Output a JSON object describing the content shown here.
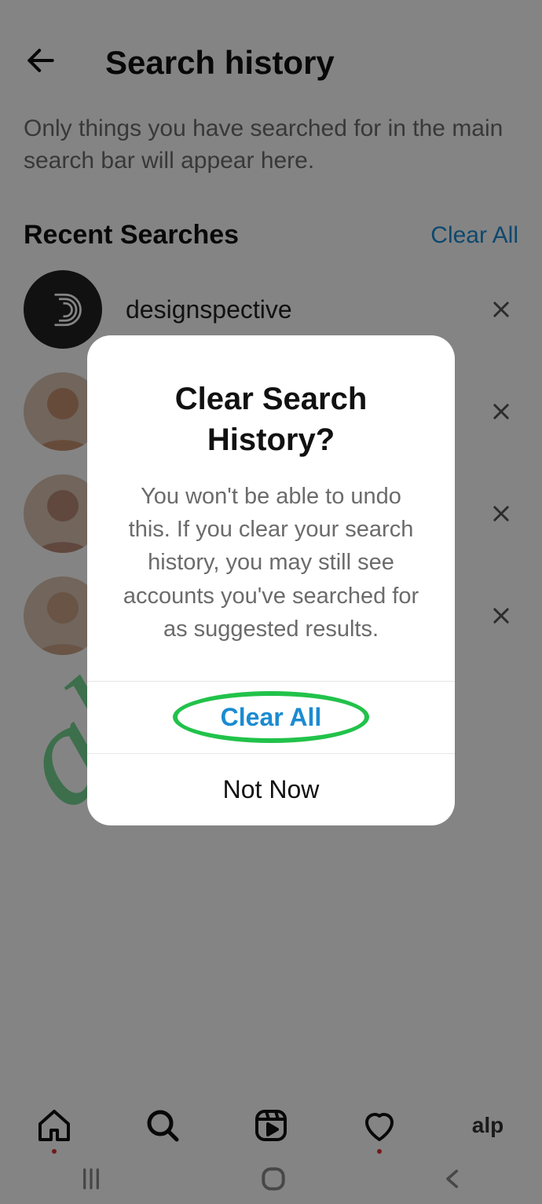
{
  "header": {
    "title": "Search history"
  },
  "description": "Only things you have searched for in the main search bar will appear here.",
  "section": {
    "title": "Recent Searches",
    "clear_all": "Clear All"
  },
  "items": [
    {
      "label": "designspective"
    },
    {
      "label": ""
    },
    {
      "label": ""
    },
    {
      "label": ""
    }
  ],
  "modal": {
    "title": "Clear Search History?",
    "body": "You won't be able to undo this. If you clear your search history, you may still see accounts you've searched for as suggested results.",
    "primary": "Clear All",
    "secondary": "Not Now"
  },
  "watermark": "alphr.com",
  "profile_tab": "alp"
}
